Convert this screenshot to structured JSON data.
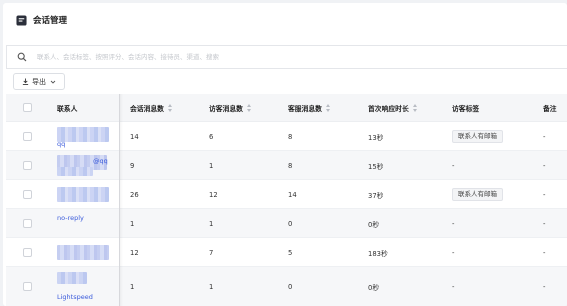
{
  "header": {
    "title": "会话管理",
    "icon": "chat-session-icon"
  },
  "search": {
    "placeholder": "联系人、会话标签、按照评分、会话内容、接待员、渠道、搜索",
    "icon": "search-icon"
  },
  "toolbar": {
    "export_label": "导出"
  },
  "table": {
    "columns": [
      "联系人",
      "会话消息数",
      "访客消息数",
      "客服消息数",
      "首次响应时长",
      "访客标签",
      "备注"
    ],
    "rows": [
      {
        "contact_text": "qq",
        "session_msgs": "14",
        "visitor_msgs": "6",
        "agent_msgs": "8",
        "first_response": "13秒",
        "visitor_tag": "联系人有邮箱",
        "note": "-"
      },
      {
        "contact_text": "@qq",
        "session_msgs": "9",
        "visitor_msgs": "1",
        "agent_msgs": "8",
        "first_response": "15秒",
        "visitor_tag": "-",
        "note": "-"
      },
      {
        "contact_text": "",
        "session_msgs": "26",
        "visitor_msgs": "12",
        "agent_msgs": "14",
        "first_response": "37秒",
        "visitor_tag": "联系人有邮箱",
        "note": "-"
      },
      {
        "contact_text": "no-reply",
        "session_msgs": "1",
        "visitor_msgs": "1",
        "agent_msgs": "0",
        "first_response": "0秒",
        "visitor_tag": "-",
        "note": "-"
      },
      {
        "contact_text": "",
        "session_msgs": "12",
        "visitor_msgs": "7",
        "agent_msgs": "5",
        "first_response": "183秒",
        "visitor_tag": "-",
        "note": "-"
      },
      {
        "contact_text": "Lightspeed",
        "session_msgs": "1",
        "visitor_msgs": "1",
        "agent_msgs": "0",
        "first_response": "0秒",
        "visitor_tag": "-",
        "note": "-"
      }
    ]
  },
  "colors": {
    "link": "#3b5bdb",
    "header_bg": "#f5f6f8",
    "alt_row_bg": "#f6f7f9"
  }
}
